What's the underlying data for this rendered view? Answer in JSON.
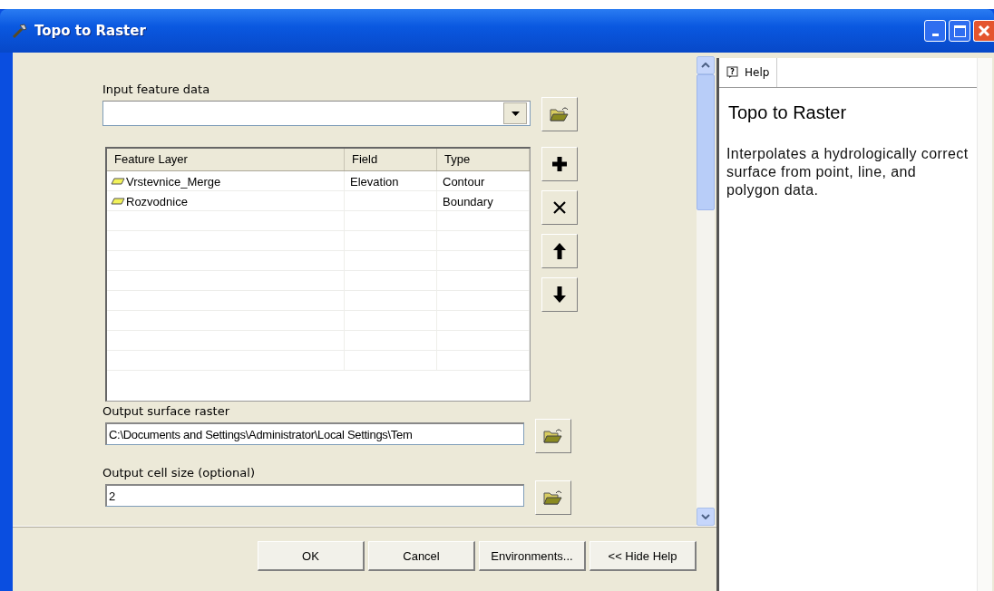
{
  "window": {
    "title": "Topo to Raster"
  },
  "form": {
    "input_label": "Input feature data",
    "table": {
      "columns": [
        "Feature Layer",
        "Field",
        "Type"
      ],
      "rows": [
        {
          "layer": "Vrstevnice_Merge",
          "field": "Elevation",
          "type": "Contour"
        },
        {
          "layer": "Rozvodnice",
          "type": "Boundary"
        }
      ]
    },
    "output_label": "Output surface raster",
    "output_value": "C:\\Documents and Settings\\Administrator\\Local Settings\\Tem",
    "cell_label": "Output cell size (optional)",
    "cell_value": "2"
  },
  "buttons": [
    "OK",
    "Cancel",
    "Environments...",
    "<< Hide Help"
  ],
  "help": {
    "tab_icon": "?",
    "tab": "Help",
    "title": "Topo to Raster",
    "text": "Interpolates a hydrologically correct surface from point, line, and polygon data."
  }
}
